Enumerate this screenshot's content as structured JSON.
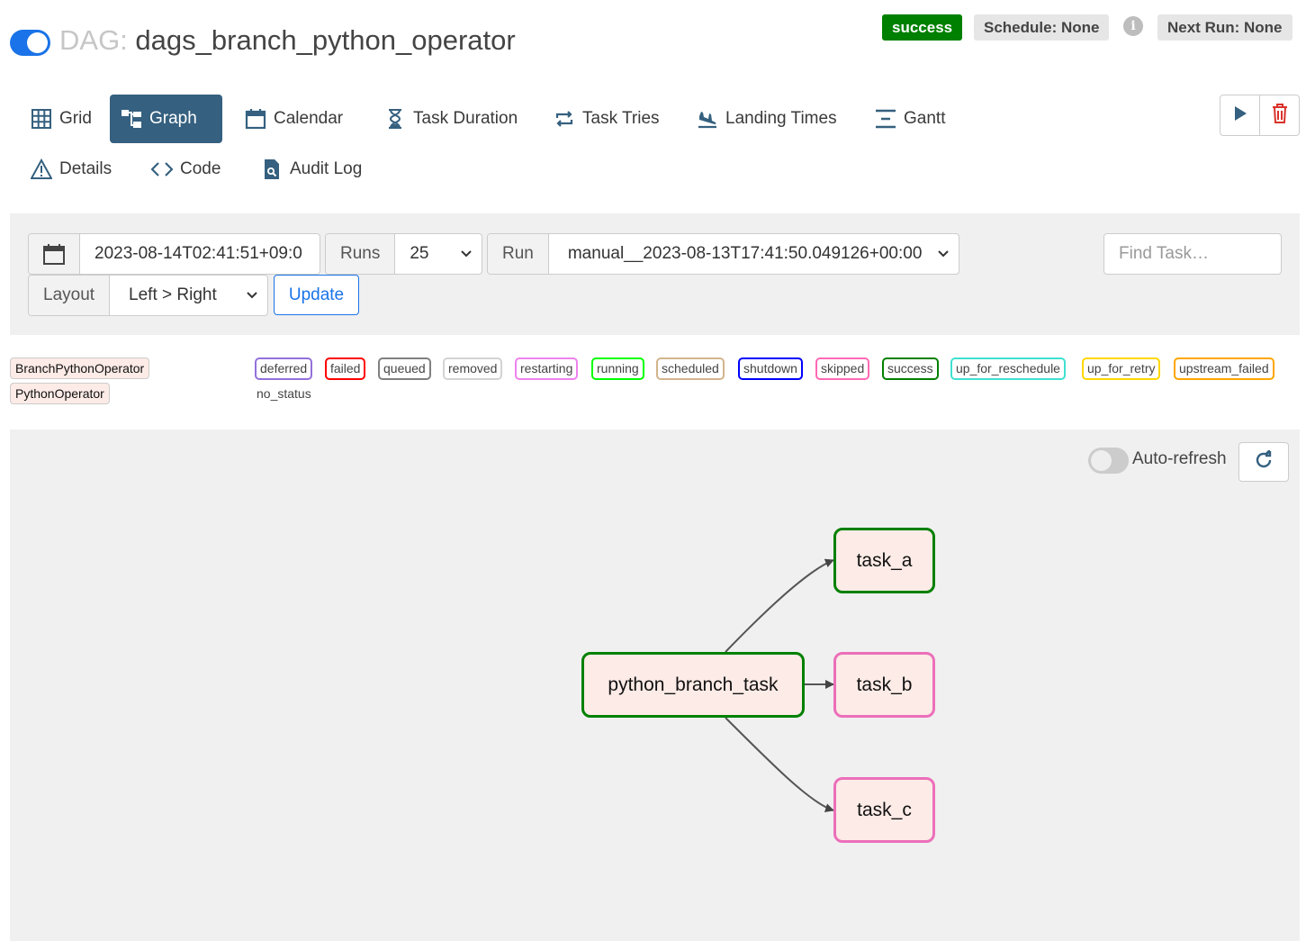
{
  "header": {
    "dag_prefix": "DAG:",
    "dag_name": "dags_branch_python_operator",
    "status_badge": "success",
    "schedule": "Schedule: None",
    "info_icon": "i",
    "next_run": "Next Run: None"
  },
  "nav": {
    "grid": "Grid",
    "graph": "Graph",
    "calendar": "Calendar",
    "task_duration": "Task Duration",
    "task_tries": "Task Tries",
    "landing_times": "Landing Times",
    "gantt": "Gantt",
    "details": "Details",
    "code": "Code",
    "audit_log": "Audit Log"
  },
  "controls": {
    "base_date": "2023-08-14T02:41:51+09:0",
    "runs_label": "Runs",
    "runs_value": "25",
    "run_label": "Run",
    "run_value": "manual__2023-08-13T17:41:50.049126+00:00",
    "find_placeholder": "Find Task…",
    "layout_label": "Layout",
    "layout_value": "Left > Right",
    "update_label": "Update"
  },
  "legend": {
    "operators": [
      "BranchPythonOperator",
      "PythonOperator"
    ],
    "states": [
      {
        "label": "deferred",
        "color": "#9370db"
      },
      {
        "label": "failed",
        "color": "#ff0000"
      },
      {
        "label": "queued",
        "color": "#808080"
      },
      {
        "label": "removed",
        "color": "#d3d3d3"
      },
      {
        "label": "restarting",
        "color": "#ee82ee"
      },
      {
        "label": "running",
        "color": "#00ff00"
      },
      {
        "label": "scheduled",
        "color": "#d2b48c"
      },
      {
        "label": "shutdown",
        "color": "#0000ff"
      },
      {
        "label": "skipped",
        "color": "#ff69b4"
      },
      {
        "label": "success",
        "color": "#008000"
      },
      {
        "label": "up_for_reschedule",
        "color": "#40e0d0"
      },
      {
        "label": "up_for_retry",
        "color": "#ffd700"
      },
      {
        "label": "upstream_failed",
        "color": "#ffa500"
      }
    ],
    "no_status": "no_status"
  },
  "graph": {
    "auto_refresh_label": "Auto-refresh",
    "nodes": {
      "branch": "python_branch_task",
      "a": "task_a",
      "b": "task_b",
      "c": "task_c"
    }
  },
  "colors": {
    "success": "#008000",
    "skipped": "#ff69b4",
    "accent": "#1a73e8",
    "active_tab": "#35607f",
    "node_fill": "#fcebe6"
  }
}
